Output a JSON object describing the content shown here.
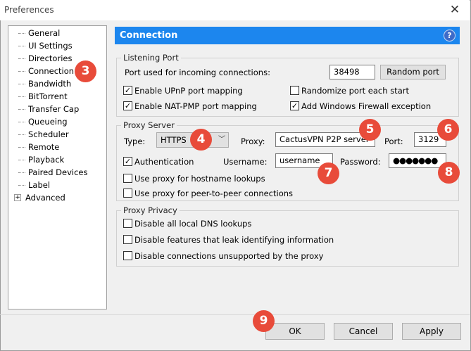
{
  "window": {
    "title": "Preferences"
  },
  "tree": {
    "items": [
      {
        "label": "General"
      },
      {
        "label": "UI Settings"
      },
      {
        "label": "Directories"
      },
      {
        "label": "Connection"
      },
      {
        "label": "Bandwidth"
      },
      {
        "label": "BitTorrent"
      },
      {
        "label": "Transfer Cap"
      },
      {
        "label": "Queueing"
      },
      {
        "label": "Scheduler"
      },
      {
        "label": "Remote"
      },
      {
        "label": "Playback"
      },
      {
        "label": "Paired Devices"
      },
      {
        "label": "Label"
      },
      {
        "label": "Advanced",
        "expandable": "+"
      }
    ]
  },
  "header": {
    "title": "Connection",
    "help": "?"
  },
  "listening": {
    "legend": "Listening Port",
    "port_label": "Port used for incoming connections:",
    "port_value": "38498",
    "random_button": "Random port",
    "upnp": {
      "label": "Enable UPnP port mapping",
      "checked": "✓"
    },
    "natpmp": {
      "label": "Enable NAT-PMP port mapping",
      "checked": "✓"
    },
    "randomize": {
      "label": "Randomize port each start",
      "checked": ""
    },
    "firewall": {
      "label": "Add Windows Firewall exception",
      "checked": "✓"
    }
  },
  "proxy": {
    "legend": "Proxy Server",
    "type_label": "Type:",
    "type_value": "HTTPS",
    "proxy_label": "Proxy:",
    "proxy_value": "CactusVPN P2P server",
    "port_label": "Port:",
    "port_value": "3129",
    "auth": {
      "label": "Authentication",
      "checked": "✓"
    },
    "username_label": "Username:",
    "username_value": "username",
    "password_label": "Password:",
    "password_value": "●●●●●●●",
    "hostname": {
      "label": "Use proxy for hostname lookups",
      "checked": ""
    },
    "p2p": {
      "label": "Use proxy for peer-to-peer connections",
      "checked": ""
    }
  },
  "privacy": {
    "legend": "Proxy Privacy",
    "dns": {
      "label": "Disable all local DNS lookups",
      "checked": ""
    },
    "leak": {
      "label": "Disable features that leak identifying information",
      "checked": ""
    },
    "unsupported": {
      "label": "Disable connections unsupported by the proxy",
      "checked": ""
    }
  },
  "buttons": {
    "ok": "OK",
    "cancel": "Cancel",
    "apply": "Apply"
  },
  "badges": [
    "3",
    "4",
    "5",
    "6",
    "7",
    "8",
    "9"
  ],
  "colors": {
    "header": "#1c86ee",
    "badge": "#e84b3a"
  }
}
